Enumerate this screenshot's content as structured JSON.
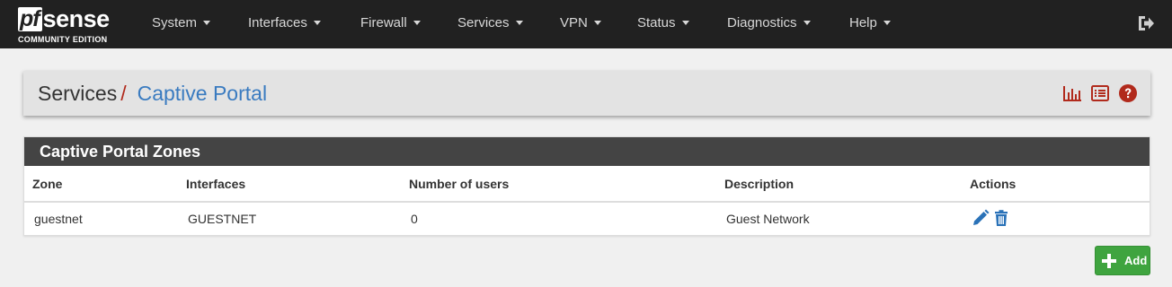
{
  "brand": {
    "name_boxed": "pf",
    "name_rest": "sense",
    "edition": "COMMUNITY EDITION"
  },
  "nav": {
    "items": [
      {
        "label": "System",
        "icon": "caret-down"
      },
      {
        "label": "Interfaces",
        "icon": "caret-down"
      },
      {
        "label": "Firewall",
        "icon": "caret-down"
      },
      {
        "label": "Services",
        "icon": "caret-down"
      },
      {
        "label": "VPN",
        "icon": "caret-down"
      },
      {
        "label": "Status",
        "icon": "caret-down"
      },
      {
        "label": "Diagnostics",
        "icon": "caret-down"
      },
      {
        "label": "Help",
        "icon": "caret-down"
      }
    ],
    "logout_icon": "sign-out-icon"
  },
  "breadcrumb": {
    "parent": "Services",
    "separator": "/",
    "current": "Captive Portal",
    "icons": [
      "bar-chart-icon",
      "list-icon",
      "question-circle-icon"
    ]
  },
  "zones": {
    "heading": "Captive Portal Zones",
    "columns": [
      "Zone",
      "Interfaces",
      "Number of users",
      "Description",
      "Actions"
    ],
    "rows": [
      {
        "zone": "guestnet",
        "interfaces": "GUESTNET",
        "users": "0",
        "description": "Guest Network"
      }
    ]
  },
  "add_button": {
    "label": "Add",
    "icon": "plus-icon"
  },
  "colors": {
    "navbar": "#212121",
    "accent_red": "#b12a1c",
    "link_blue": "#3a7bc0",
    "success_green": "#3fa43f",
    "panel_heading": "#444444"
  }
}
